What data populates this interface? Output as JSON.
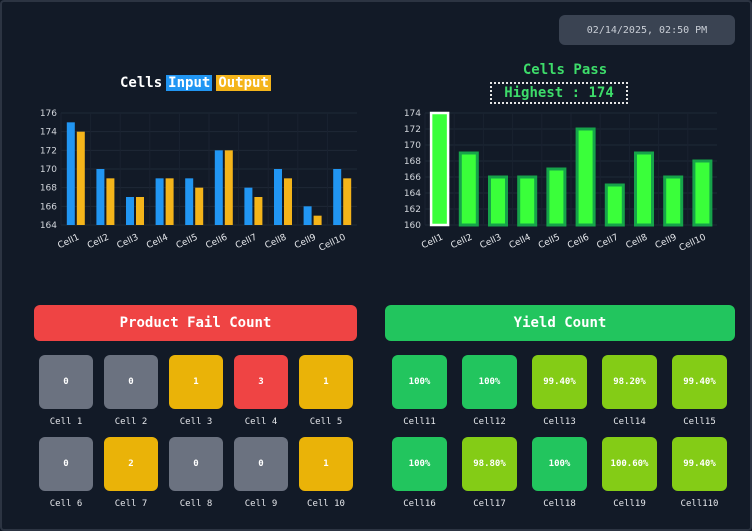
{
  "datetime": "02/14/2025, 02:50 PM",
  "left_chart": {
    "title_prefix": "Cells",
    "legend_input": "Input",
    "legend_output": "Output"
  },
  "right_chart": {
    "title": "Cells Pass",
    "highest_label": "Highest : 174"
  },
  "chart_data": [
    {
      "type": "bar",
      "categories": [
        "Cell1",
        "Cell2",
        "Cell3",
        "Cell4",
        "Cell5",
        "Cell6",
        "Cell7",
        "Cell8",
        "Cell9",
        "Cell10"
      ],
      "series": [
        {
          "name": "Input",
          "values": [
            175,
            170,
            167,
            169,
            169,
            172,
            168,
            170,
            166,
            170
          ]
        },
        {
          "name": "Output",
          "values": [
            174,
            169,
            167,
            169,
            168,
            172,
            167,
            169,
            165,
            169
          ]
        }
      ],
      "ylim": [
        164,
        176
      ],
      "yticks": [
        164,
        166,
        168,
        170,
        172,
        174,
        176
      ],
      "colors": {
        "Input": "#2196f3",
        "Output": "#f4b41a"
      }
    },
    {
      "type": "bar",
      "categories": [
        "Cell1",
        "Cell2",
        "Cell3",
        "Cell4",
        "Cell5",
        "Cell6",
        "Cell7",
        "Cell8",
        "Cell9",
        "Cell10"
      ],
      "series": [
        {
          "values": [
            174,
            169,
            166,
            166,
            167,
            172,
            165,
            169,
            166,
            168
          ]
        }
      ],
      "ylim": [
        160,
        174
      ],
      "yticks": [
        160,
        162,
        164,
        166,
        168,
        170,
        172,
        174
      ],
      "colors": {
        "bar": "#3aff3a",
        "highest": "#ffffff"
      }
    }
  ],
  "fail_panel": {
    "title": "Product Fail Count",
    "cells": [
      {
        "label": "Cell 1",
        "value": "0",
        "color": "#6b7280"
      },
      {
        "label": "Cell 2",
        "value": "0",
        "color": "#6b7280"
      },
      {
        "label": "Cell 3",
        "value": "1",
        "color": "#eab308"
      },
      {
        "label": "Cell 4",
        "value": "3",
        "color": "#ef4444"
      },
      {
        "label": "Cell 5",
        "value": "1",
        "color": "#eab308"
      },
      {
        "label": "Cell 6",
        "value": "0",
        "color": "#6b7280"
      },
      {
        "label": "Cell 7",
        "value": "2",
        "color": "#eab308"
      },
      {
        "label": "Cell 8",
        "value": "0",
        "color": "#6b7280"
      },
      {
        "label": "Cell 9",
        "value": "0",
        "color": "#6b7280"
      },
      {
        "label": "Cell 10",
        "value": "1",
        "color": "#eab308"
      }
    ]
  },
  "yield_panel": {
    "title": "Yield Count",
    "cells": [
      {
        "label": "Cell11",
        "value": "100%",
        "color": "#22c55e"
      },
      {
        "label": "Cell12",
        "value": "100%",
        "color": "#22c55e"
      },
      {
        "label": "Cell13",
        "value": "99.40%",
        "color": "#84cc16"
      },
      {
        "label": "Cell14",
        "value": "98.20%",
        "color": "#84cc16"
      },
      {
        "label": "Cell15",
        "value": "99.40%",
        "color": "#84cc16"
      },
      {
        "label": "Cell16",
        "value": "100%",
        "color": "#22c55e"
      },
      {
        "label": "Cell17",
        "value": "98.80%",
        "color": "#84cc16"
      },
      {
        "label": "Cell18",
        "value": "100%",
        "color": "#22c55e"
      },
      {
        "label": "Cell19",
        "value": "100.60%",
        "color": "#84cc16"
      },
      {
        "label": "Cell110",
        "value": "99.40%",
        "color": "#84cc16"
      }
    ]
  }
}
